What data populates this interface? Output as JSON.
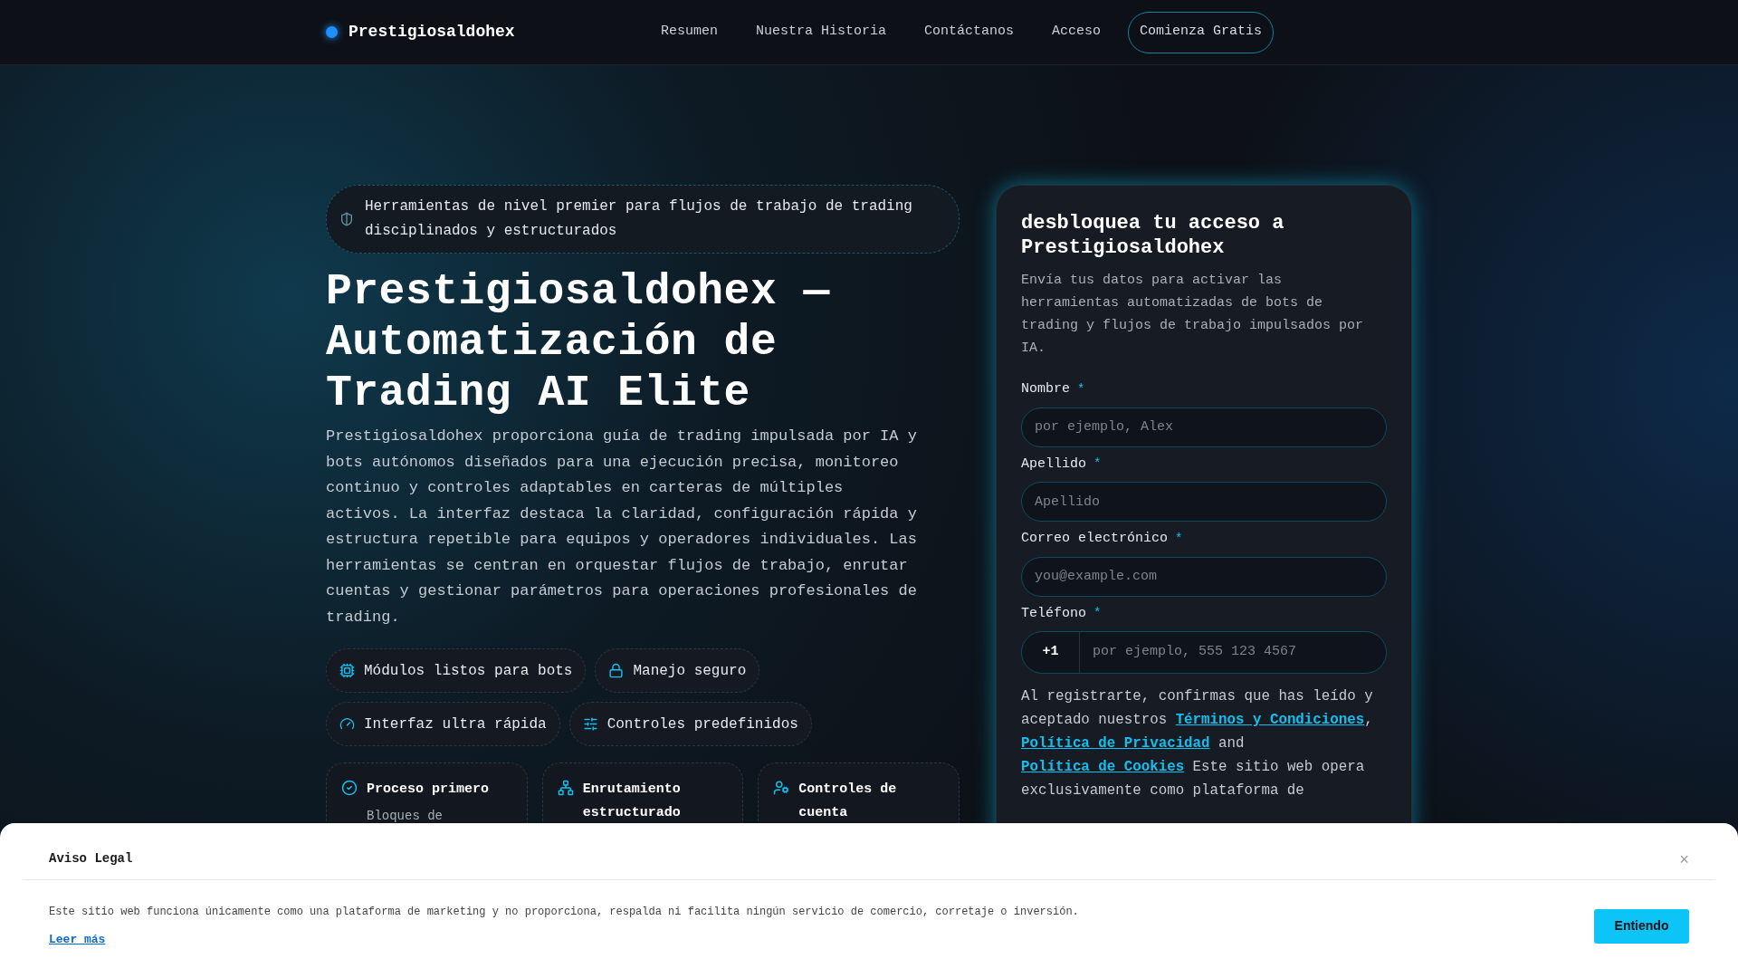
{
  "header": {
    "logo": "Prestigiosaldohex",
    "nav": [
      "Resumen",
      "Nuestra Historia",
      "Contáctanos",
      "Acceso"
    ],
    "cta": "Comienza Gratis"
  },
  "hero": {
    "badge": "Herramientas de nivel premier para flujos de trabajo de trading disciplinados y estructurados",
    "title": "Prestigiosaldohex — Automatización de Trading AI Elite",
    "description": "Prestigiosaldohex proporciona guía de trading impulsada por IA y bots autónomos diseñados para una ejecución precisa, monitoreo continuo y controles adaptables en carteras de múltiples activos. La interfaz destaca la claridad, configuración rápida y estructura repetible para equipos y operadores individuales. Las herramientas se centran en orquestar flujos de trabajo, enrutar cuentas y gestionar parámetros para operaciones profesionales de trading.",
    "features": [
      "Módulos listos para bots",
      "Manejo seguro",
      "Interfaz ultra rápida",
      "Controles predefinidos"
    ],
    "cards": [
      {
        "title": "Proceso primero",
        "text": "Bloques de"
      },
      {
        "title": "Enrutamiento estructurado"
      },
      {
        "title": "Controles de cuenta"
      }
    ]
  },
  "form": {
    "title": "desbloquea tu acceso a Prestigiosaldohex",
    "subtitle": "Envía tus datos para activar las herramientas automatizadas de bots de trading y flujos de trabajo impulsados por IA.",
    "fields": [
      {
        "kind": "text",
        "label": "Nombre",
        "required_mark": "*",
        "placeholder": "por ejemplo, Alex"
      },
      {
        "kind": "text",
        "label": "Apellido",
        "required_mark": "*",
        "placeholder": "Apellido"
      },
      {
        "kind": "text",
        "label": "Correo electrónico",
        "required_mark": "*",
        "placeholder": "you@example.com"
      },
      {
        "kind": "phone",
        "label": "Teléfono",
        "required_mark": "*",
        "prefix": "+1",
        "placeholder": "por ejemplo, 555 123 4567"
      }
    ],
    "legal": [
      {
        "kind": "text",
        "text": "Al registrarte, confirmas que has leído y aceptado nuestros "
      },
      {
        "kind": "link",
        "text": "Términos y Condiciones"
      },
      {
        "kind": "text",
        "text": ", "
      },
      {
        "kind": "link",
        "text": "Política de Privacidad"
      },
      {
        "kind": "text",
        "text": " and "
      },
      {
        "kind": "link",
        "text": "Política de Cookies"
      },
      {
        "kind": "text",
        "text": " Este sitio web opera exclusivamente como plataforma de"
      }
    ]
  },
  "cookie_banner": {
    "title": "Aviso Legal",
    "close": "×",
    "text": "Este sitio web funciona únicamente como una plataforma de marketing y no proporciona, respalda ni facilita ningún servicio de comercio, corretaje o inversión.",
    "link": "Leer más",
    "button": "Entiendo"
  }
}
